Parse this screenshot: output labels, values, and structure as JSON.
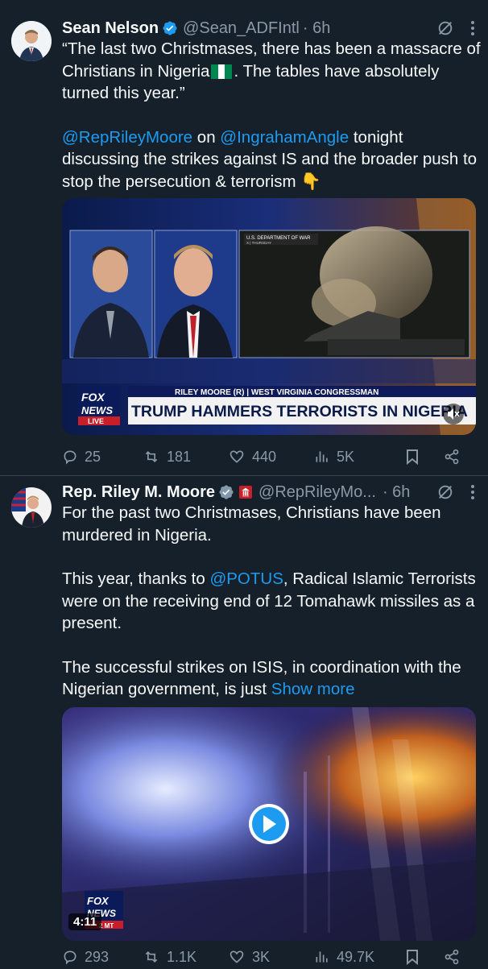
{
  "tweets": [
    {
      "author_name": "Sean Nelson",
      "handle": "@Sean_ADFIntl",
      "time": "· 6h",
      "body_line1": "“The last two Christmases, there has been a massacre of Christians in Nigeria",
      "body_line1_end": ". The tables have absolutely turned this year.”",
      "mention1": "@RepRileyMoore",
      "on_word": " on ",
      "mention2": "@IngrahamAngle",
      "body_line2": " tonight discussing the strikes against IS and the broader push to stop the persecution & terrorism",
      "emoji": "👇",
      "media": {
        "source_tag": "U.S. DEPARTMENT OF WAR",
        "source_sub": "X | THURSDAY",
        "lower_third_small": "RILEY MOORE (R) | WEST VIRGINIA CONGRESSMAN",
        "lower_third_big": "TRUMP HAMMERS TERRORISTS IN NIGERIA",
        "logo_top": "FOX",
        "logo_bottom": "NEWS",
        "live": "LIVE"
      },
      "stats": {
        "replies": "25",
        "reposts": "181",
        "likes": "440",
        "views": "5K"
      }
    },
    {
      "author_name": "Rep. Riley M. Moore",
      "handle": "@RepRileyMo...",
      "time": "· 6h",
      "p1": "For the past two Christmases, Christians have been murdered in Nigeria.",
      "p2_pre": "This year, thanks to ",
      "p2_mention": "@POTUS",
      "p2_post": ", Radical Islamic Terrorists were on the receiving end of 12 Tomahawk missiles as a present.",
      "p3": "The successful strikes on ISIS, in coordination with the Nigerian government, is just ",
      "show_more": "Show more",
      "media": {
        "duration": "4:11",
        "logo_top": "FOX",
        "logo_bottom": "NEWS",
        "logo_sub": "2 MT"
      },
      "stats": {
        "replies": "293",
        "reposts": "1.1K",
        "likes": "3K",
        "views": "49.7K"
      }
    }
  ],
  "colors": {
    "background": "#15202b",
    "accent": "#1d9bf0",
    "muted": "#8b98a5",
    "divider": "#38444d"
  }
}
